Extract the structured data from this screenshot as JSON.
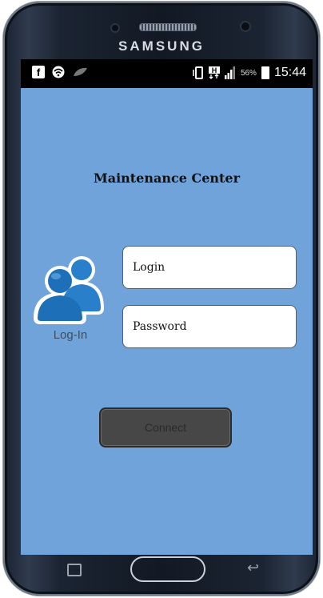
{
  "device": {
    "brand": "SAMSUNG"
  },
  "status_bar": {
    "left_icons": [
      "facebook-icon",
      "wifi-icon",
      "leaf-icon"
    ],
    "right_icons": [
      "vibrate-icon",
      "data-h-icon",
      "signal-icon",
      "battery-icon"
    ],
    "battery_percent": "56%",
    "time": "15:44"
  },
  "screen": {
    "title": "Maintenance Center",
    "icon_caption": "Log-In",
    "login_placeholder": "Login",
    "password_placeholder": "Password",
    "connect_label": "Connect"
  },
  "colors": {
    "screen_bg": "#6fa3da",
    "button_bg": "#474747",
    "icon_blue": "#1d6fb8"
  },
  "nav_bar": {
    "buttons": [
      "recent-apps",
      "home",
      "back"
    ]
  }
}
